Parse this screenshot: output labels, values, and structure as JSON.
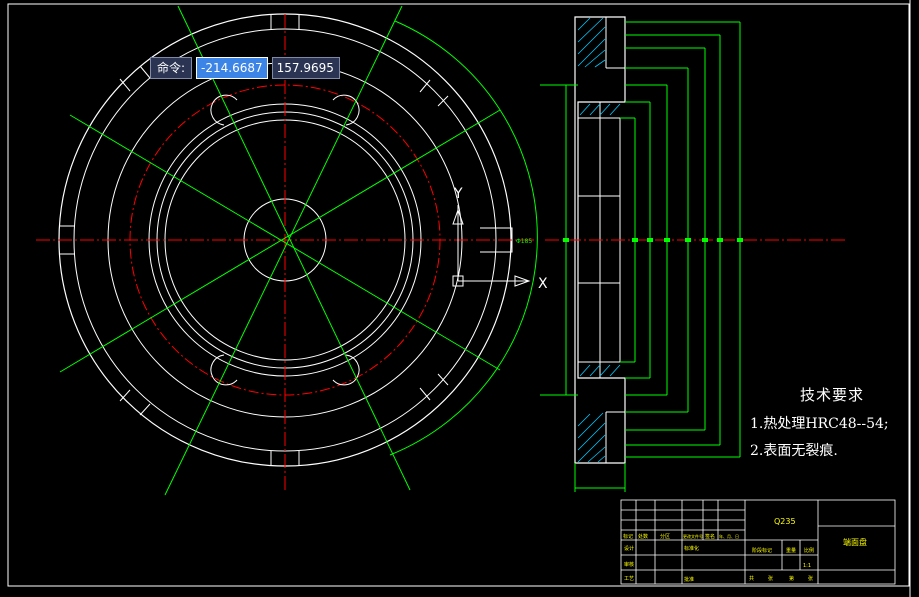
{
  "command_input": {
    "label": "命令:",
    "x_value": "-214.6687",
    "y_value": "157.9695"
  },
  "ucs_icon": {
    "y_axis": "Y",
    "x_axis": "X"
  },
  "tech_requirements": {
    "title": "技术要求",
    "items": [
      "1.热处理HRC48--54;",
      "2.表面无裂痕."
    ]
  },
  "title_block": {
    "material": "Q235",
    "part_name": "端面盘",
    "scale": "1:1",
    "row_labels": [
      "标记",
      "处数",
      "分区",
      "更改文件号",
      "签名",
      "年、月、日"
    ],
    "left_labels": [
      "设计",
      "审核",
      "工艺"
    ],
    "mid_labels": [
      "标准化",
      "批准"
    ],
    "stage_labels": [
      "阶段标记",
      "重量",
      "比例"
    ],
    "sheet_labels": [
      "共",
      "张",
      "第",
      "张"
    ]
  },
  "colors": {
    "background": "#000000",
    "outline": "#ffffff",
    "centerline": "#ff0000",
    "dimension": "#00ff00",
    "frame": "#ffffff",
    "title_text": "#ffff00",
    "input_highlight": "#3c84e6"
  }
}
